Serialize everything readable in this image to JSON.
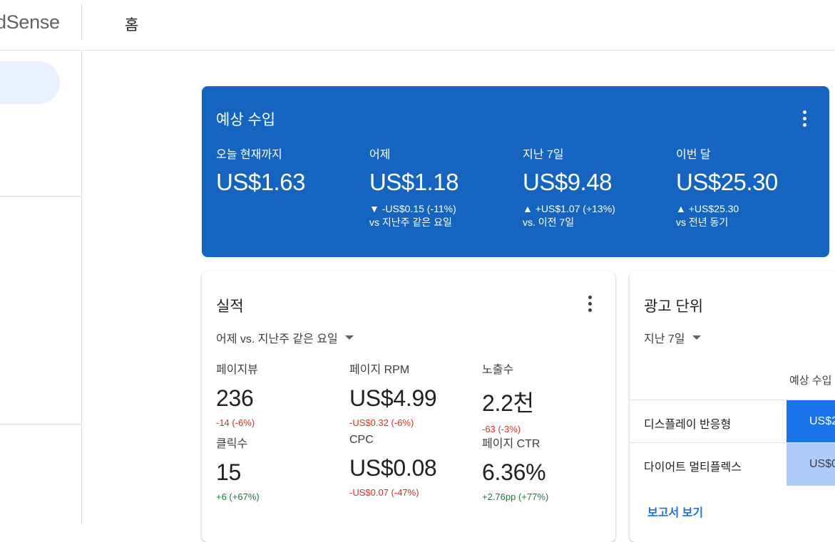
{
  "app": {
    "logo_text": "dSense",
    "page_title": "홈"
  },
  "earnings": {
    "title": "예상 수입",
    "metrics": [
      {
        "label": "오늘 현재까지",
        "value": "US$1.63",
        "change": "",
        "compare": ""
      },
      {
        "label": "어제",
        "value": "US$1.18",
        "change": "▼ -US$0.15 (-11%)",
        "compare": "vs 지난주 같은 요일"
      },
      {
        "label": "지난 7일",
        "value": "US$9.48",
        "change": "▲ +US$1.07 (+13%)",
        "compare": "vs. 이전 7일"
      },
      {
        "label": "이번 달",
        "value": "US$25.30",
        "change": "▲ +US$25.30",
        "compare": "vs 전년 동기"
      }
    ]
  },
  "performance": {
    "title": "실적",
    "period": "어제 vs. 지난주 같은 요일",
    "metrics": [
      {
        "label": "페이지뷰",
        "value": "236",
        "change": "-14 (-6%)",
        "trend": "negative"
      },
      {
        "label": "페이지 RPM",
        "value": "US$4.99",
        "change": "-US$0.32 (-6%)",
        "trend": "negative"
      },
      {
        "label": "노출수",
        "value": "2.2천",
        "change": "-63 (-3%)",
        "trend": "negative"
      },
      {
        "label": "클릭수",
        "value": "15",
        "change": "+6 (+67%)",
        "trend": "positive"
      },
      {
        "label": "CPC",
        "value": "US$0.08",
        "change": "-US$0.07 (-47%)",
        "trend": "negative"
      },
      {
        "label": "페이지 CTR",
        "value": "6.36%",
        "change": "+2.76pp (+77%)",
        "trend": "positive"
      }
    ]
  },
  "ad_units": {
    "title": "광고 단위",
    "period": "지난 7일",
    "column_header": "예상 수입",
    "rows": [
      {
        "name": "디스플레이 반응형",
        "value": "US$2",
        "bar_color": "#1a73e8",
        "text_color": "#ffffff"
      },
      {
        "name": "다이어트 멀티플렉스",
        "value": "US$0",
        "bar_color": "#aecbfa",
        "text_color": "#3c4043"
      }
    ],
    "report_link": "보고서 보기"
  },
  "colors": {
    "earnings_card": "#1565c0",
    "negative": "#d93025",
    "positive": "#188038",
    "link": "#1a73e8",
    "nav_active": "#e8f0fe"
  }
}
